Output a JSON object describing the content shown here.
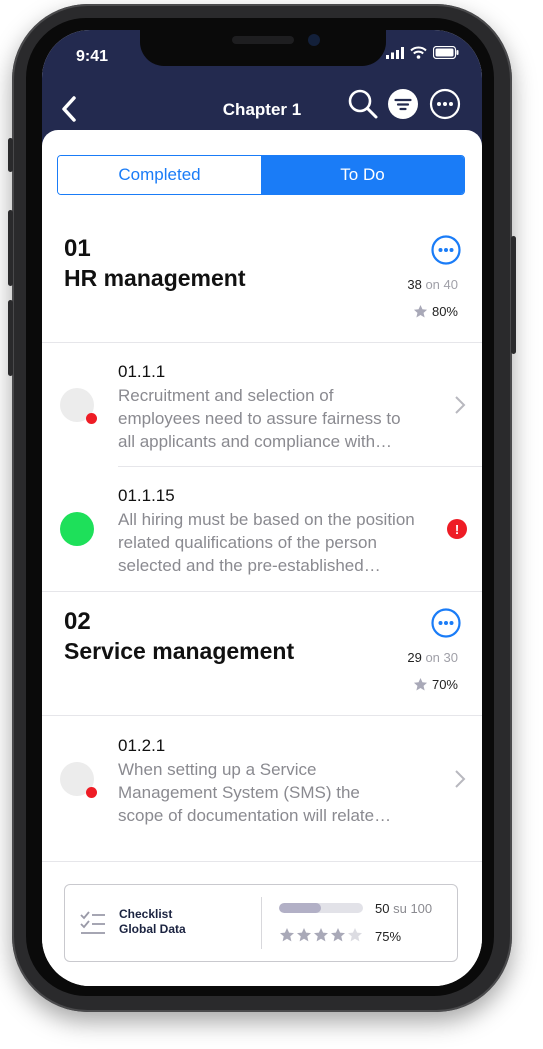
{
  "status_bar": {
    "time": "9:41"
  },
  "nav": {
    "title": "Chapter 1"
  },
  "tabs": [
    {
      "label": "Completed",
      "active": false
    },
    {
      "label": "To Do",
      "active": true
    }
  ],
  "sections": [
    {
      "number": "01",
      "title": "HR management",
      "done": "38",
      "on_label": "on",
      "total": "40",
      "rating": "80%",
      "items": [
        {
          "code": "01.1.1",
          "text_lines": [
            "Recruitment and selection of",
            "employees need to assure fairness to",
            "all applicants and compliance with…"
          ],
          "status": "pending",
          "trailing": "chevron"
        },
        {
          "code": "01.1.15",
          "text_lines": [
            "All hiring must be based on the position",
            "related qualifications of the person",
            "selected and the pre-established…"
          ],
          "status": "complete",
          "trailing": "alert",
          "alert_symbol": "!"
        }
      ]
    },
    {
      "number": "02",
      "title": "Service management",
      "done": "29",
      "on_label": "on",
      "total": "30",
      "rating": "70%",
      "items": [
        {
          "code": "01.2.1",
          "text_lines": [
            "When setting up a Service",
            "Management System (SMS) the",
            "scope of documentation will relate…"
          ],
          "status": "pending",
          "trailing": "chevron"
        }
      ]
    }
  ],
  "footer": {
    "label_line1": "Checklist",
    "label_line2": "Global Data",
    "done": "50",
    "su_label": "su",
    "total": "100",
    "progress": 0.5,
    "stars_filled": 4,
    "stars_total": 5,
    "rating": "75%"
  },
  "icons": {
    "back": "chevron-left-icon",
    "search": "search-icon",
    "filter": "filter-icon",
    "more": "more-horizontal-icon",
    "star": "star-icon",
    "checklist": "checklist-icon"
  },
  "colors": {
    "header": "#232a4f",
    "accent": "#1a7cf7",
    "red": "#ee1c25",
    "green": "#1ee05a",
    "star": "#a9a9b8"
  }
}
